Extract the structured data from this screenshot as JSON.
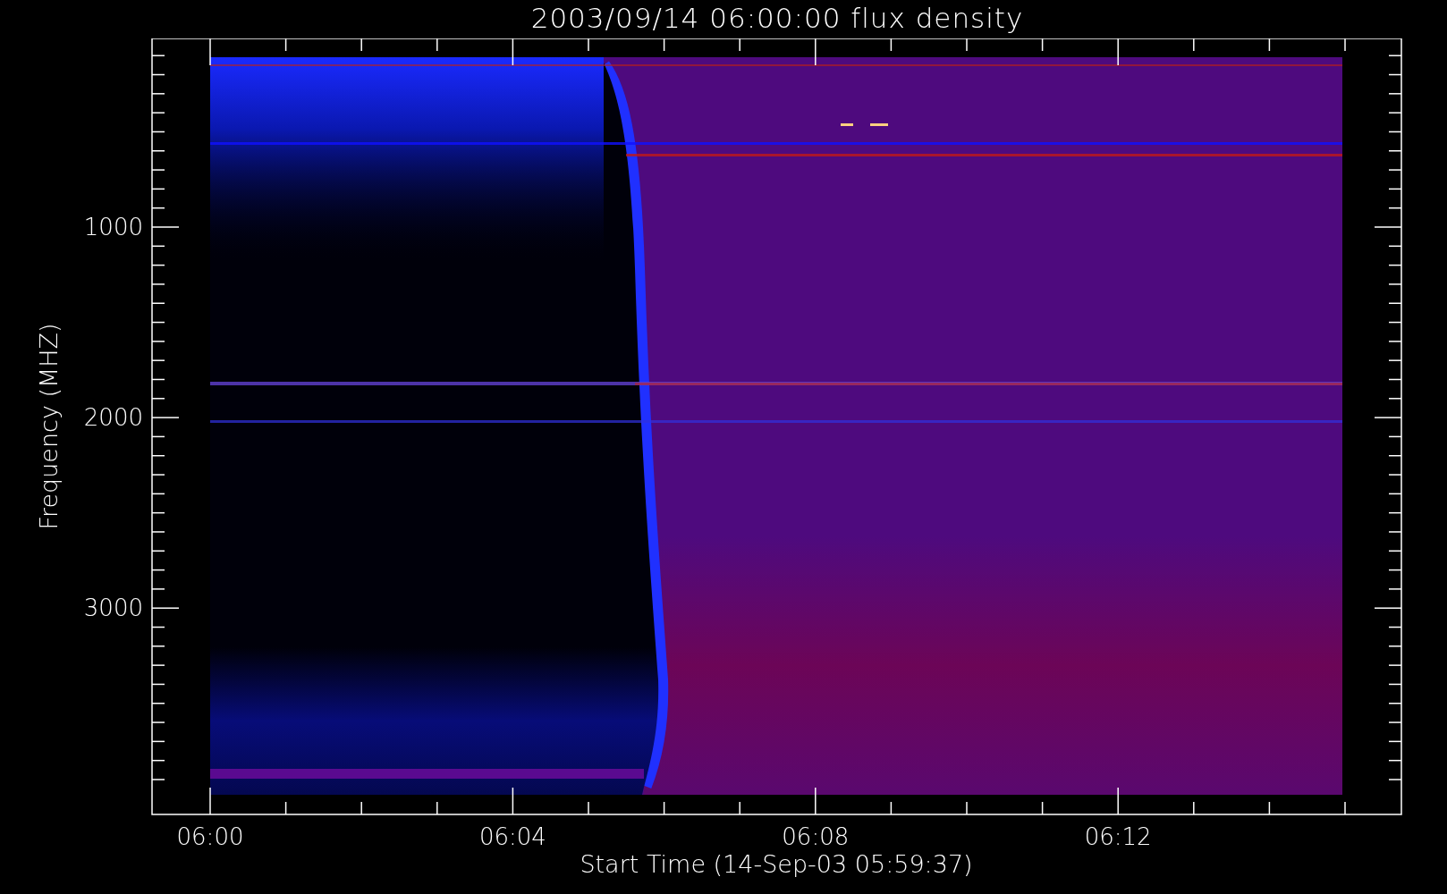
{
  "title": "2003/09/14 06:00:00 flux density",
  "plot": {
    "ylabel": "Frequency (MHZ)",
    "xlabel": "Start Time (14-Sep-03 05:59:37)",
    "y_tick_labels": [
      "1000",
      "2000",
      "3000"
    ],
    "x_tick_labels": [
      "06:00",
      "06:04",
      "06:08",
      "06:12"
    ]
  }
}
